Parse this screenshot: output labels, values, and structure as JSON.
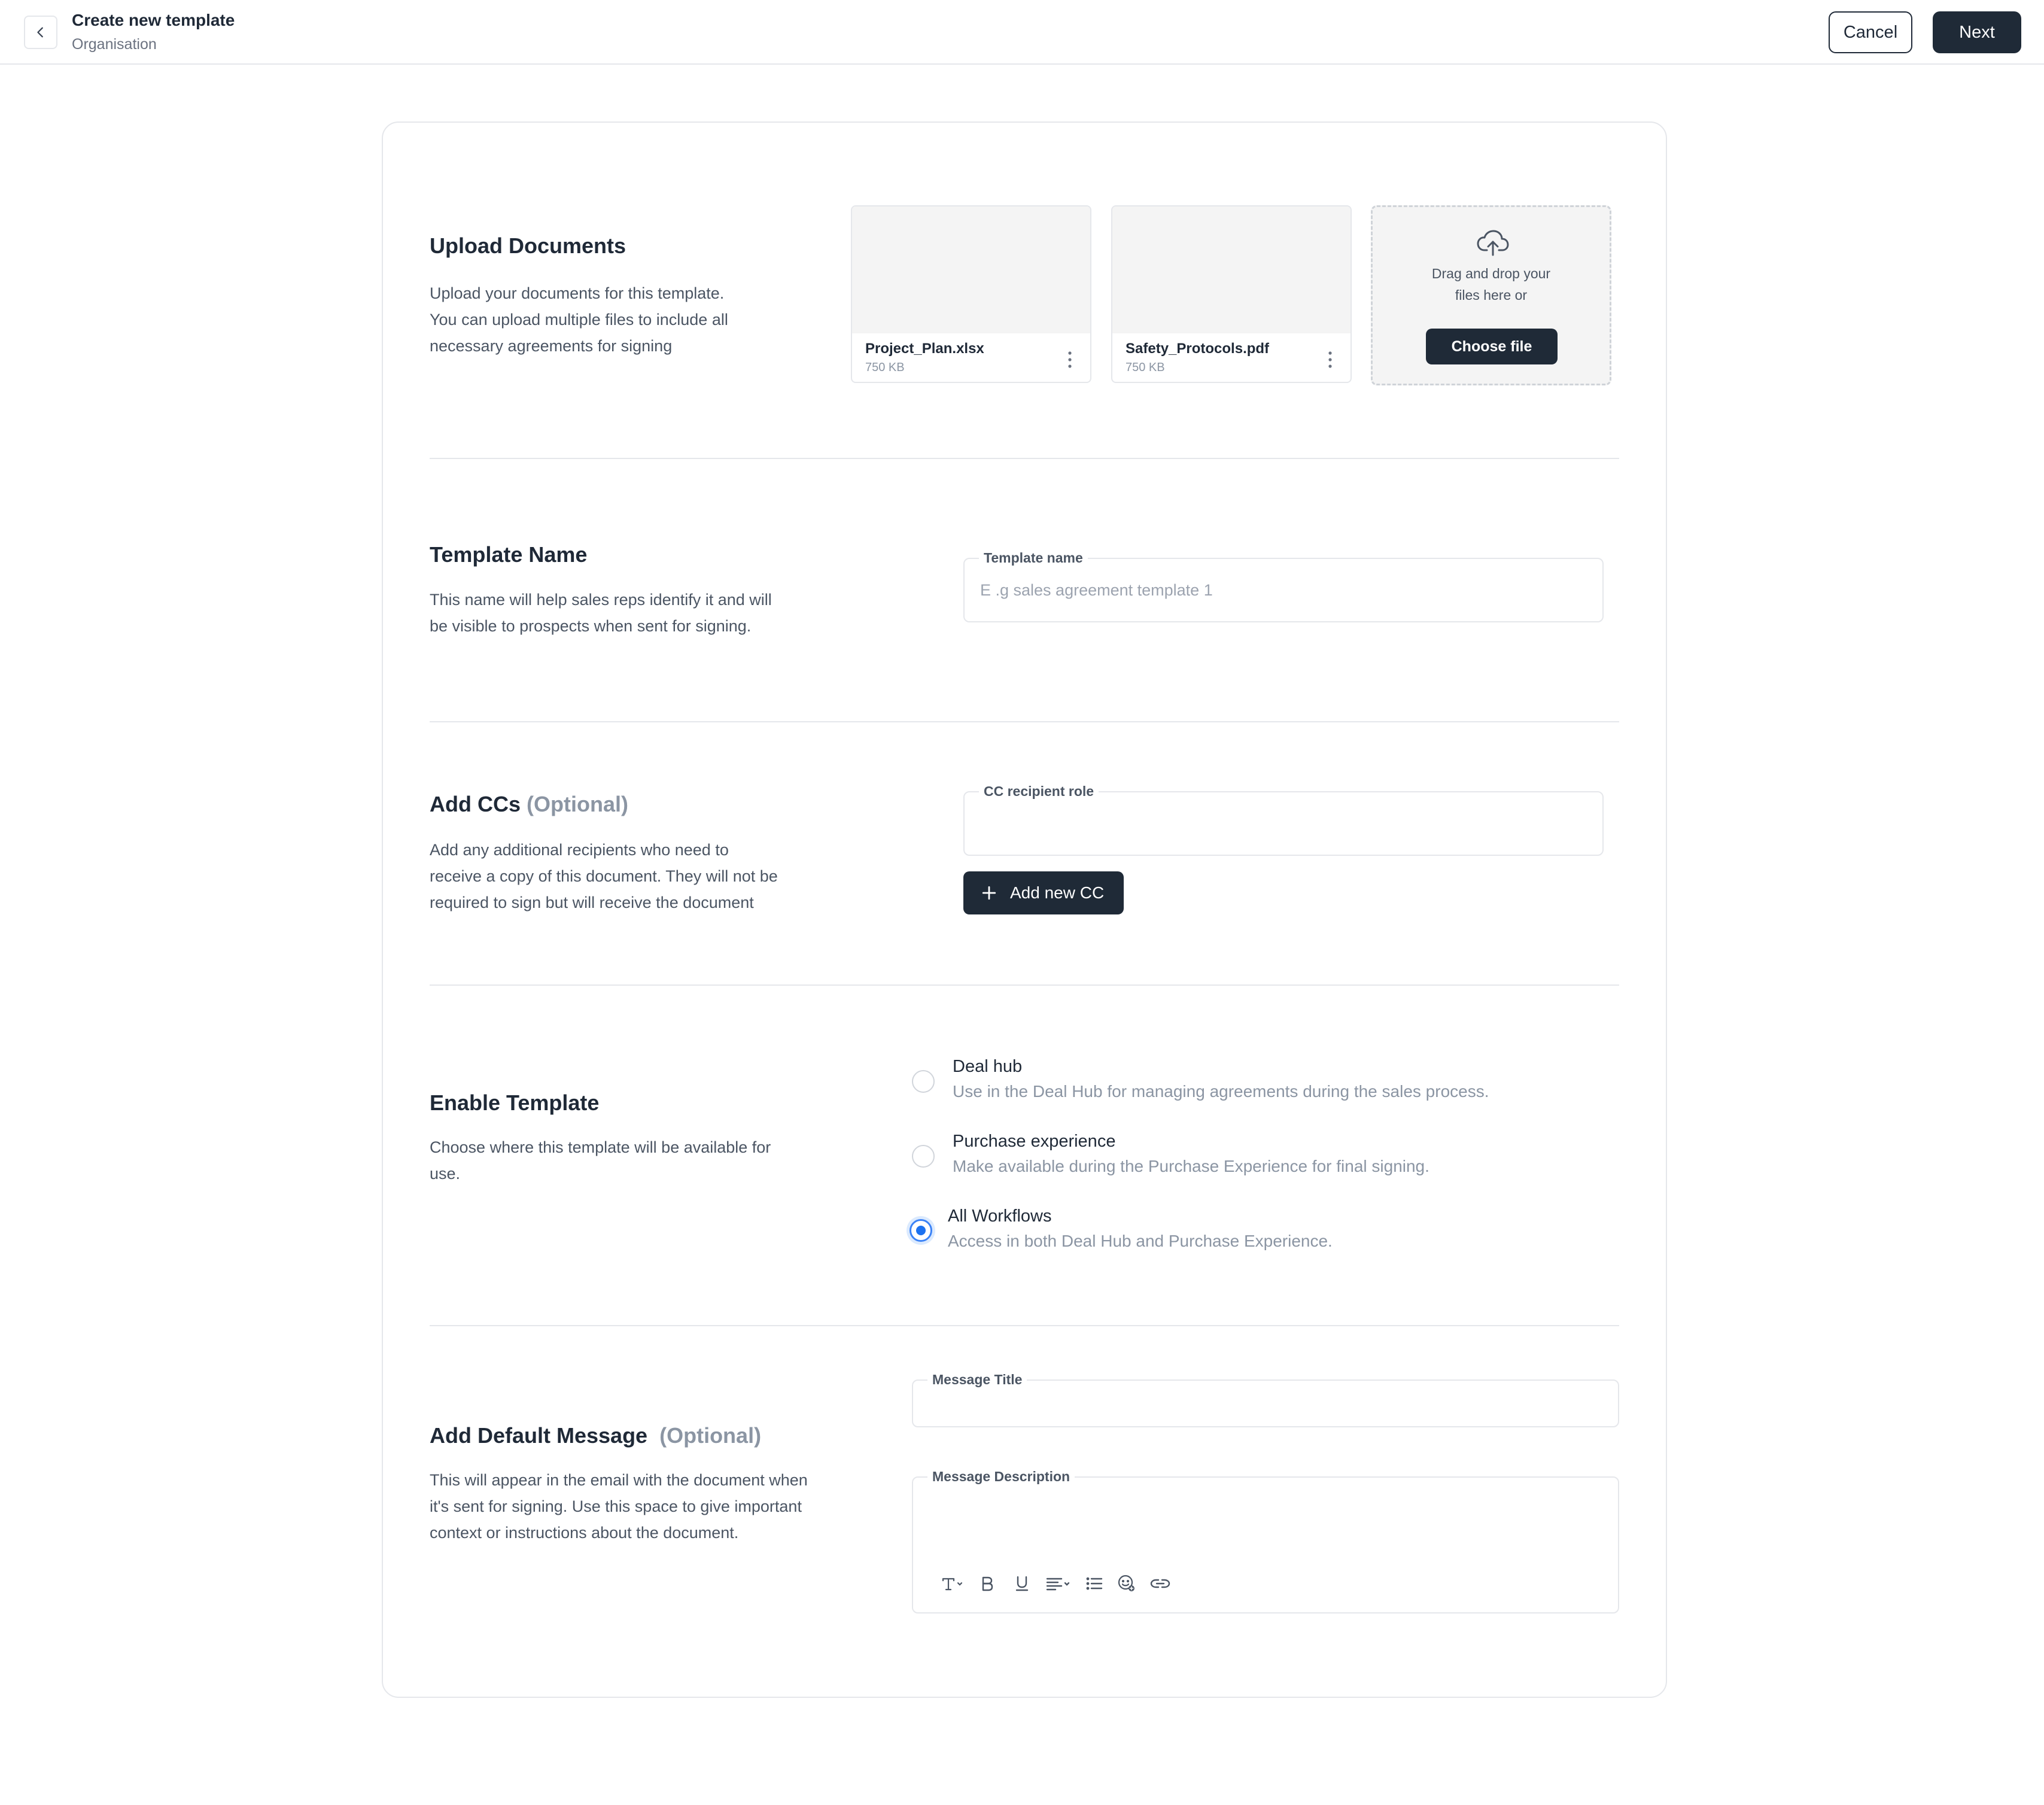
{
  "header": {
    "title": "Create new template",
    "subtitle": "Organisation",
    "cancel_label": "Cancel",
    "next_label": "Next"
  },
  "upload": {
    "title": "Upload Documents",
    "description_lines": [
      "Upload your documents for this template.",
      "You can upload multiple files to include all",
      "necessary agreements for signing"
    ],
    "files": [
      {
        "name": "Project_Plan.xlsx",
        "size": "750 KB"
      },
      {
        "name": "Safety_Protocols.pdf",
        "size": "750 KB"
      }
    ],
    "dropzone_lines": [
      "Drag and drop your",
      "files here or"
    ],
    "choose_label": "Choose file"
  },
  "template_name": {
    "title": "Template Name",
    "description_lines": [
      "This name will help sales reps identify it and will",
      "be visible to prospects when sent for signing."
    ],
    "field_label": "Template name",
    "placeholder": "E .g sales agreement template 1",
    "value": ""
  },
  "ccs": {
    "title": "Add CCs",
    "optional": "(Optional)",
    "description_lines": [
      "Add any additional recipients who need to",
      "receive a copy of this document. They will not be",
      "required to sign but will receive the document"
    ],
    "field_label": "CC  recipient role",
    "value": "",
    "add_label": "Add new CC"
  },
  "enable": {
    "title": "Enable Template",
    "description_lines": [
      "Choose where this template will be available for",
      "use."
    ],
    "options": [
      {
        "title": "Deal hub",
        "description": "Use in the Deal Hub for managing agreements during the sales process.",
        "checked": false
      },
      {
        "title": "Purchase experience",
        "description": "Make available during the Purchase Experience for final signing.",
        "checked": false
      },
      {
        "title": "All Workflows",
        "description": "Access in both Deal Hub and Purchase Experience.",
        "checked": true
      }
    ]
  },
  "message": {
    "title": "Add Default Message",
    "optional": "(Optional)",
    "description_lines": [
      "This will appear in the email with the document when",
      "it's sent for signing. Use this space to give important",
      "context or instructions about the document."
    ],
    "title_field_label": "Message Title",
    "title_value": "",
    "desc_field_label": "Message Description",
    "desc_value": "",
    "toolbar_icons": [
      "text-style-icon",
      "bold-icon",
      "underline-icon",
      "align-icon",
      "list-icon",
      "emoji-icon",
      "link-icon"
    ]
  },
  "colors": {
    "primary_dark": "#1f2a37",
    "accent_blue": "#1d72f0",
    "muted": "#8b95a3"
  }
}
